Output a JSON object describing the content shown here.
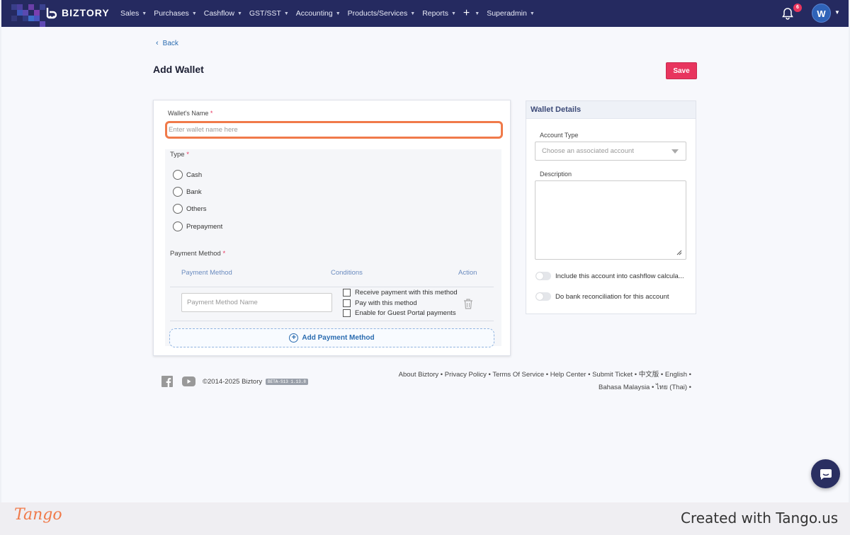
{
  "nav": {
    "brand": "BIZTORY",
    "menu": [
      {
        "label": "Sales"
      },
      {
        "label": "Purchases"
      },
      {
        "label": "Cashflow"
      },
      {
        "label": "GST/SST"
      },
      {
        "label": "Accounting"
      },
      {
        "label": "Products/Services"
      },
      {
        "label": "Reports"
      }
    ],
    "plus_label": "+",
    "superadmin_label": "Superadmin",
    "notification_count": "6",
    "avatar_initial": "W"
  },
  "page": {
    "back_label": "Back",
    "title": "Add Wallet",
    "save_label": "Save"
  },
  "form": {
    "wallet_name_label": "Wallet's Name",
    "wallet_name_placeholder": "Enter wallet name here",
    "type_label": "Type",
    "types": [
      "Cash",
      "Bank",
      "Others",
      "Prepayment"
    ],
    "payment_method_label": "Payment Method",
    "pm_table": {
      "col_method": "Payment Method",
      "col_conditions": "Conditions",
      "col_action": "Action",
      "name_placeholder": "Payment Method Name",
      "conditions": [
        "Receive payment with this method",
        "Pay with this method",
        "Enable for Guest Portal payments"
      ]
    },
    "add_pm_label": "Add Payment Method"
  },
  "details": {
    "title": "Wallet Details",
    "account_type_label": "Account Type",
    "account_type_placeholder": "Choose an associated account",
    "description_label": "Description",
    "toggle_cashflow": "Include this account into cashflow calcula...",
    "toggle_reconciliation": "Do bank reconciliation for this account"
  },
  "footer": {
    "copyright": "©2014-2025 Biztory",
    "version": "BETA-S13 1.13.8",
    "links_line1": [
      "About Biztory",
      "Privacy Policy",
      "Terms Of Service",
      "Help Center",
      "Submit Ticket",
      "中文版",
      "English"
    ],
    "links_line2": [
      "Bahasa Malaysia",
      "ไทย (Thai)"
    ]
  },
  "tango": {
    "logo": "Tango",
    "created": "Created with Tango.us"
  },
  "colors": {
    "nav_bg": "#252a60",
    "accent_red": "#e8355e",
    "focus_orange": "#f07a4a",
    "link_blue": "#2b6cb0"
  }
}
